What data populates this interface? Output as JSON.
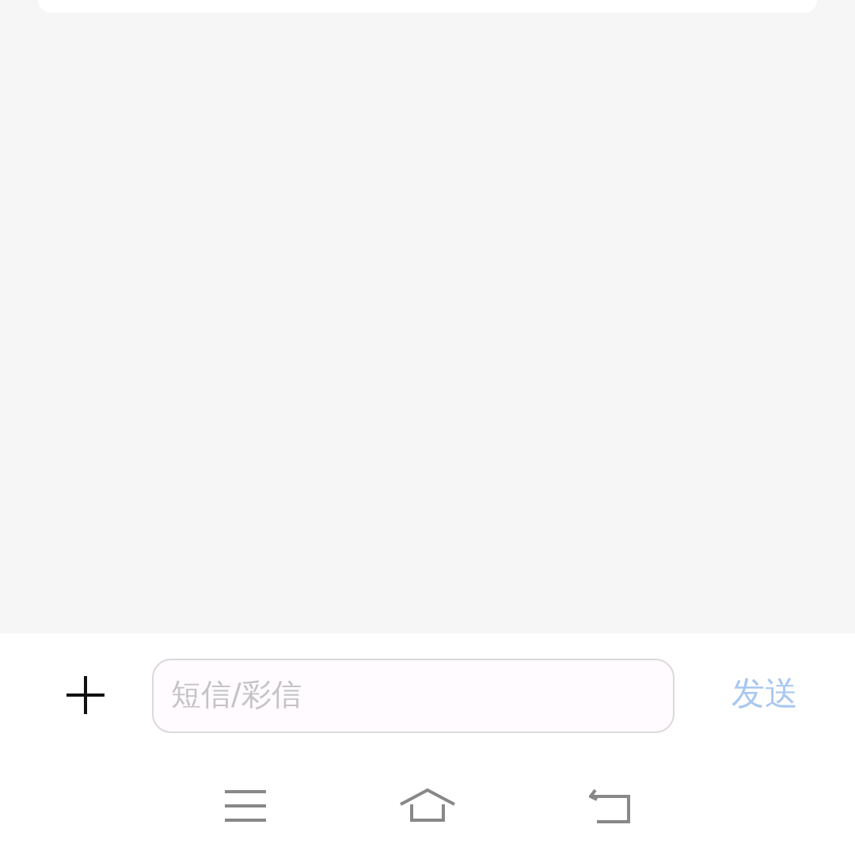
{
  "composer": {
    "placeholder": "短信/彩信",
    "send_button": {
      "label": "发送",
      "disabled": true
    }
  }
}
